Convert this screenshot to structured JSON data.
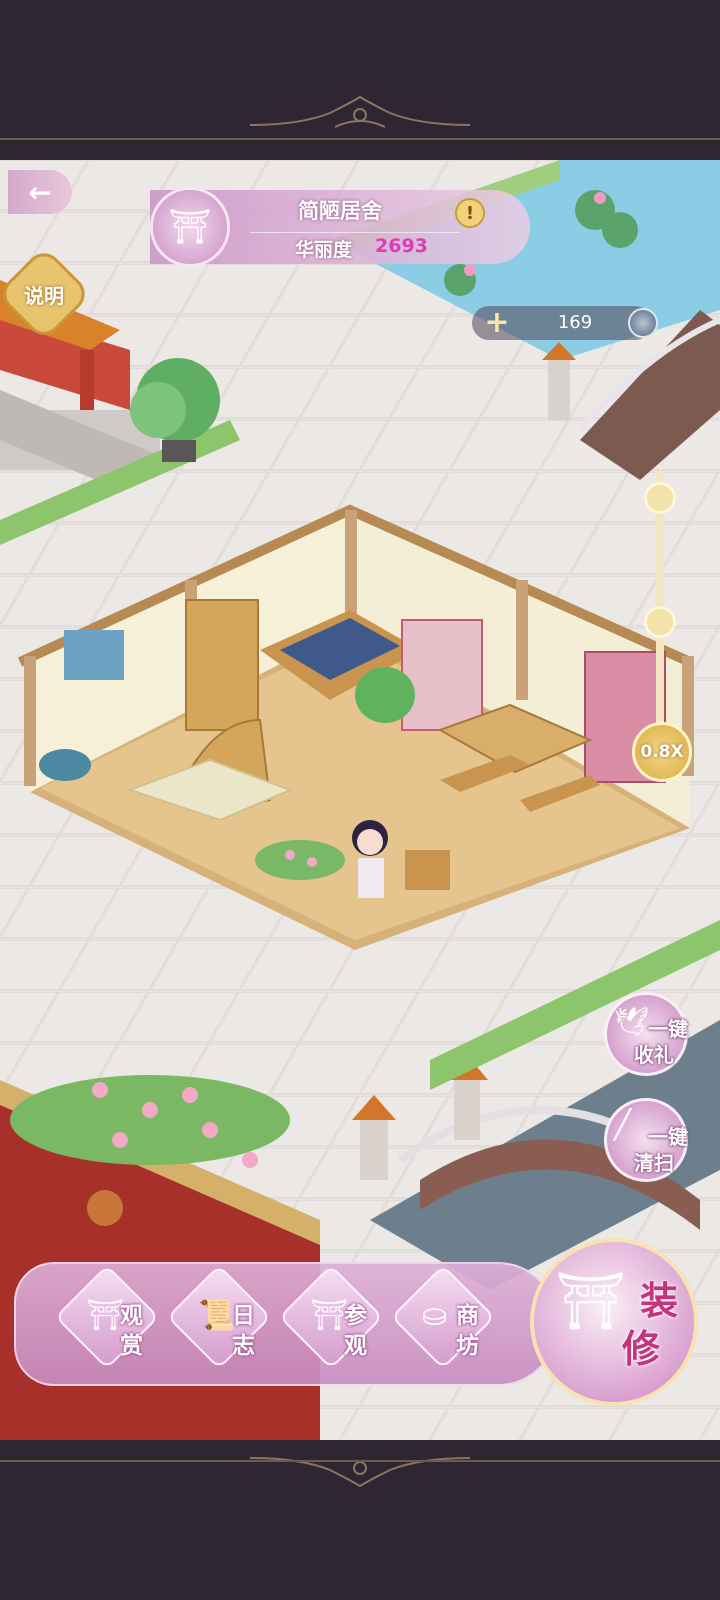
{
  "residence": {
    "name": "简陋居舍",
    "beauty_label": "华丽度",
    "beauty_value": "2693",
    "info_symbol": "!"
  },
  "top_left": {
    "back_icon": "back-arrow-icon",
    "explain_label": "说明"
  },
  "resource": {
    "plus_symbol": "+",
    "value": "169"
  },
  "zoom": {
    "label": "0.8X"
  },
  "quick_actions": {
    "collect": {
      "line1": "一键",
      "line2": "收礼"
    },
    "clean": {
      "line1": "一键",
      "line2": "清扫"
    }
  },
  "nav": {
    "view": {
      "c1": "观",
      "c2": "赏"
    },
    "log": {
      "c1": "日",
      "c2": "志"
    },
    "visit": {
      "c1": "参",
      "c2": "观"
    },
    "shop": {
      "c1": "商",
      "c2": "坊"
    },
    "decorate": {
      "c1": "装",
      "c2": "修"
    }
  },
  "colors": {
    "accent_pink": "#c98fc3",
    "beauty_value": "#e23ab0",
    "gold": "#e8c46e",
    "frame": "#2e2733"
  }
}
